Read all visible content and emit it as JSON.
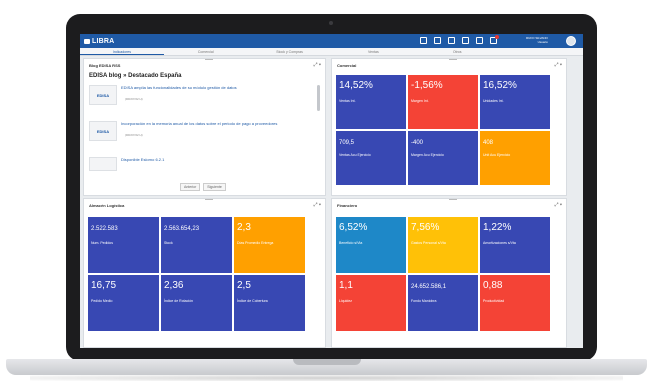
{
  "app": {
    "brand": "LIBRA"
  },
  "user": {
    "name": "RUFO SILVANO",
    "role": "Usuario"
  },
  "tabs": [
    "Indicadores",
    "Comercial",
    "Stock y Compras",
    "Ventas",
    "Otros",
    ""
  ],
  "blog": {
    "title": "Blog EDISA RSS",
    "heading": "EDISA blog » Destacado España",
    "items": [
      {
        "thumb": "EDISA",
        "text": "EDISA amplía las funcionalidades de su módulo gestión de datos",
        "date": "(DD/07/22 H)"
      },
      {
        "thumb": "EDISA",
        "text": "Incorporación en la memoria anual de los datos sobre el periodo de pago a proveedores",
        "date": "(DD/07/22 H)"
      },
      {
        "thumb": "",
        "text": "Disponible Eslorno 6.2.1",
        "date": ""
      }
    ],
    "buttons": [
      "Anterior",
      "Siguiente"
    ]
  },
  "comercial": {
    "title": "Comercial",
    "tiles": [
      {
        "value": "14,52%",
        "label": "Ventas Int.",
        "color": "#3848b3"
      },
      {
        "value": "-1,56%",
        "label": "Margen Int.",
        "color": "#f44336"
      },
      {
        "value": "16,52%",
        "label": "Unidades Int.",
        "color": "#3848b3"
      },
      {
        "value": "709,5",
        "label": "Ventas Acu Ejercicio",
        "color": "#3848b3"
      },
      {
        "value": "-400",
        "label": "Margen Acu Ejercicio",
        "color": "#3848b3"
      },
      {
        "value": "408",
        "label": "Unit Acu Ejercicio",
        "color": "#ffa000"
      }
    ]
  },
  "logistica": {
    "title": "Almacén Logística",
    "tiles": [
      {
        "value": "2.522.583",
        "label": "Num. Pedidos",
        "color": "#3848b3"
      },
      {
        "value": "2.563.654,23",
        "label": "Stock",
        "color": "#3848b3"
      },
      {
        "value": "2,3",
        "label": "Días Promedio Entrega",
        "color": "#ffa000"
      },
      {
        "value": "16,75",
        "label": "Pedido Medio",
        "color": "#3848b3"
      },
      {
        "value": "2,36",
        "label": "Índice de Rotación",
        "color": "#3848b3"
      },
      {
        "value": "2,5",
        "label": "Índice de Cobertura",
        "color": "#3848b3"
      }
    ]
  },
  "financiero": {
    "title": "Financiero",
    "tiles": [
      {
        "value": "6,52%",
        "label": "Beneficio s/Vta",
        "color": "#1e88c8"
      },
      {
        "value": "7,56%",
        "label": "Gastos Personal s/Vta",
        "color": "#ffc107"
      },
      {
        "value": "1,22%",
        "label": "Amortizaciones s/Vta",
        "color": "#3848b3"
      },
      {
        "value": "1,1",
        "label": "Liquidez",
        "color": "#f44336"
      },
      {
        "value": "24.652.586,1",
        "label": "Fondo Maniobra",
        "color": "#3848b3"
      },
      {
        "value": "0,88",
        "label": "Productividad",
        "color": "#f44336"
      }
    ]
  }
}
